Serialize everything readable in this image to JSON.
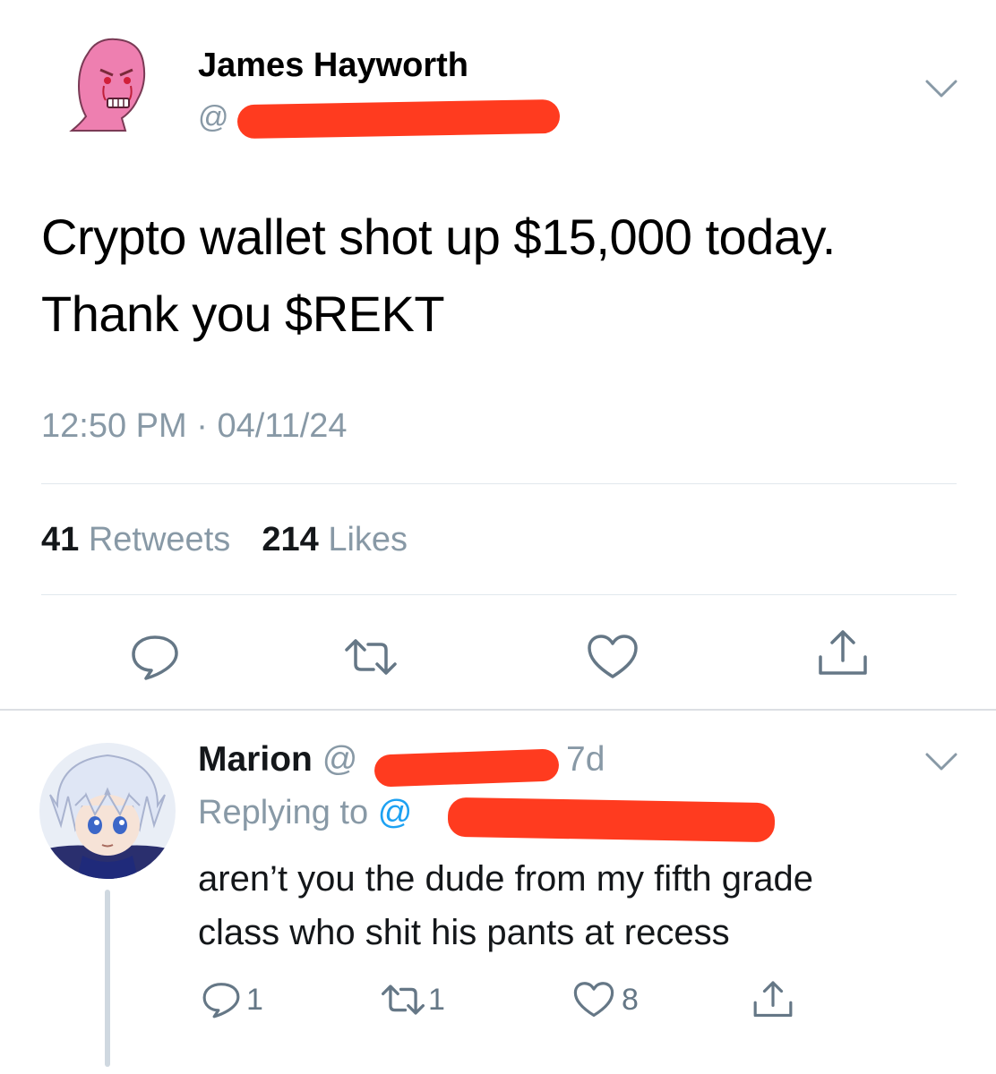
{
  "main_tweet": {
    "author_name": "James Hayworth",
    "handle_visible": "@",
    "text_line1": "Crypto wallet shot up $15,000 today.",
    "text_line2": "Thank you $REKT",
    "time": "12:50 PM",
    "date": "04/11/24",
    "retweets_count": "41",
    "retweets_label": "Retweets",
    "likes_count": "214",
    "likes_label": "Likes",
    "actions": [
      "reply-icon",
      "retweet-icon",
      "like-icon",
      "share-icon"
    ]
  },
  "reply": {
    "author_name": "Marion",
    "handle_visible": "@",
    "age": "7d",
    "replying_prefix": "Replying to",
    "replying_handle_visible": "@",
    "text_line1": "aren’t you the dude from my fifth grade",
    "text_line2": "class who shit his pants at recess",
    "reply_count": "1",
    "retweet_count": "1",
    "like_count": "8"
  },
  "colors": {
    "muted": "#8899a6",
    "link": "#1da1f2",
    "redaction": "#ff3b1f",
    "avatar_main": "#ee7fb0"
  }
}
